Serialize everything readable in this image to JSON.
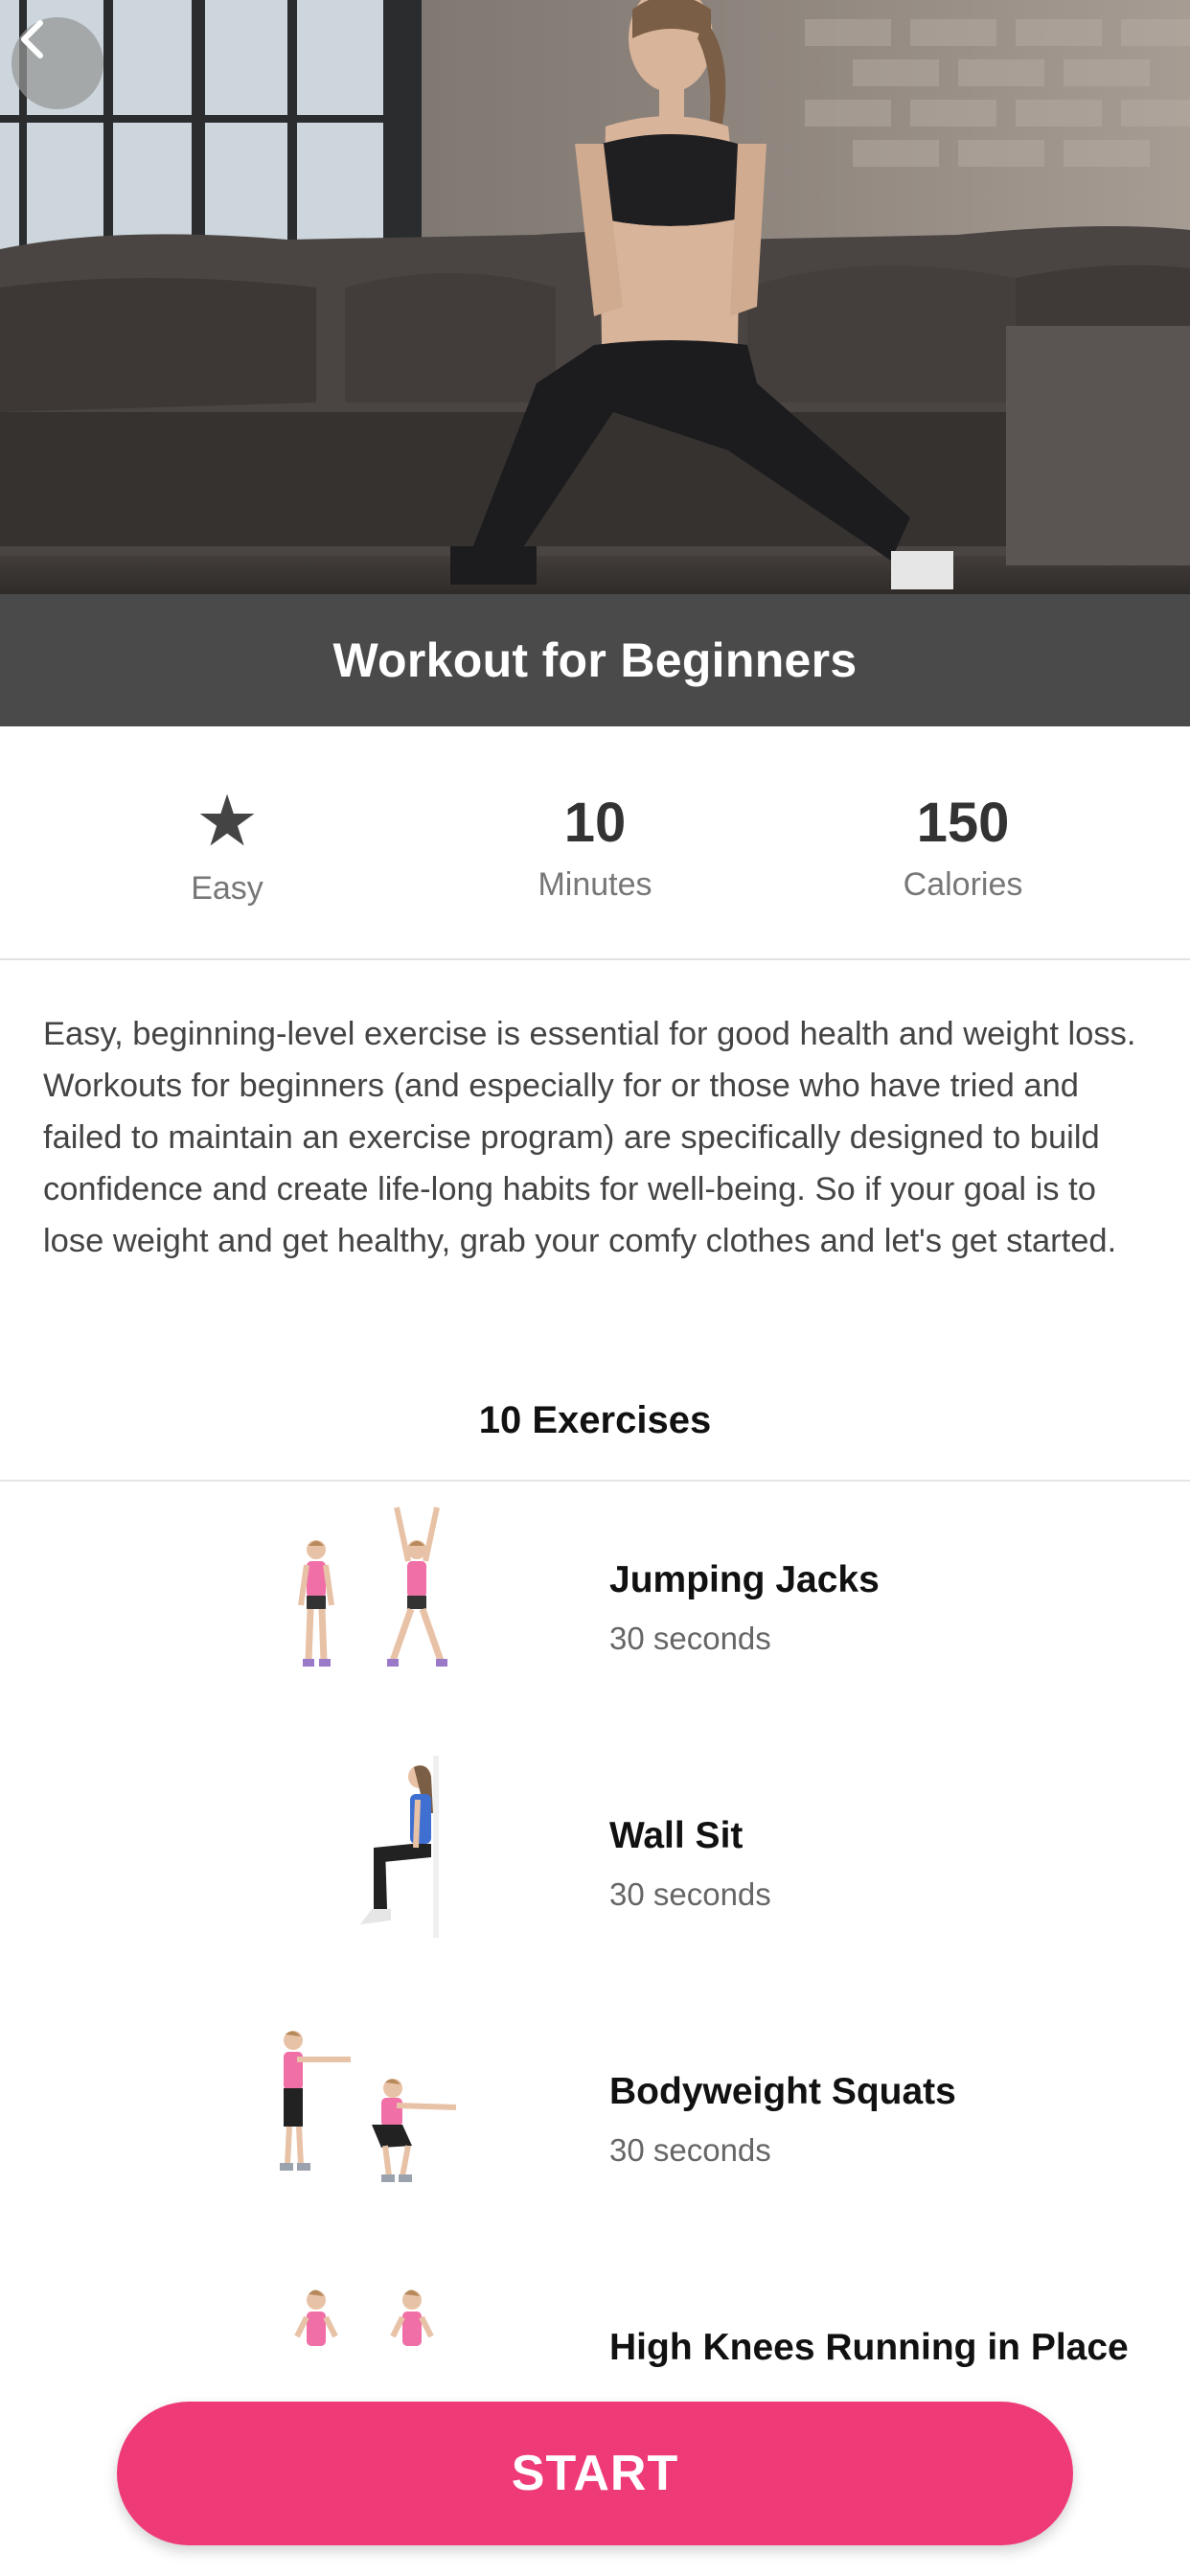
{
  "header": {
    "title": "Workout for Beginners",
    "back_icon": "chevron-left-icon"
  },
  "stats": {
    "difficulty": {
      "icon": "star-icon",
      "label": "Easy"
    },
    "duration": {
      "value": "10",
      "label": "Minutes"
    },
    "calories": {
      "value": "150",
      "label": "Calories"
    }
  },
  "description": "Easy, beginning-level exercise is essential for good health and weight loss. Workouts for beginners (and especially for or those who have tried and failed to maintain an exercise program) are specifically designed to build confidence and create life-long habits for well-being. So if your goal is to lose weight and get healthy, grab your comfy clothes and let's get started.",
  "exercises_heading": "10 Exercises",
  "exercises": [
    {
      "name": "Jumping Jacks",
      "duration": "30 seconds"
    },
    {
      "name": "Wall Sit",
      "duration": "30 seconds"
    },
    {
      "name": "Bodyweight Squats",
      "duration": "30 seconds"
    },
    {
      "name": "High Knees Running in Place",
      "duration": ""
    }
  ],
  "start_button": "START",
  "colors": {
    "accent": "#ef3a78",
    "title_bar": "#4a4a4a",
    "top_color": "#f06fa6"
  }
}
